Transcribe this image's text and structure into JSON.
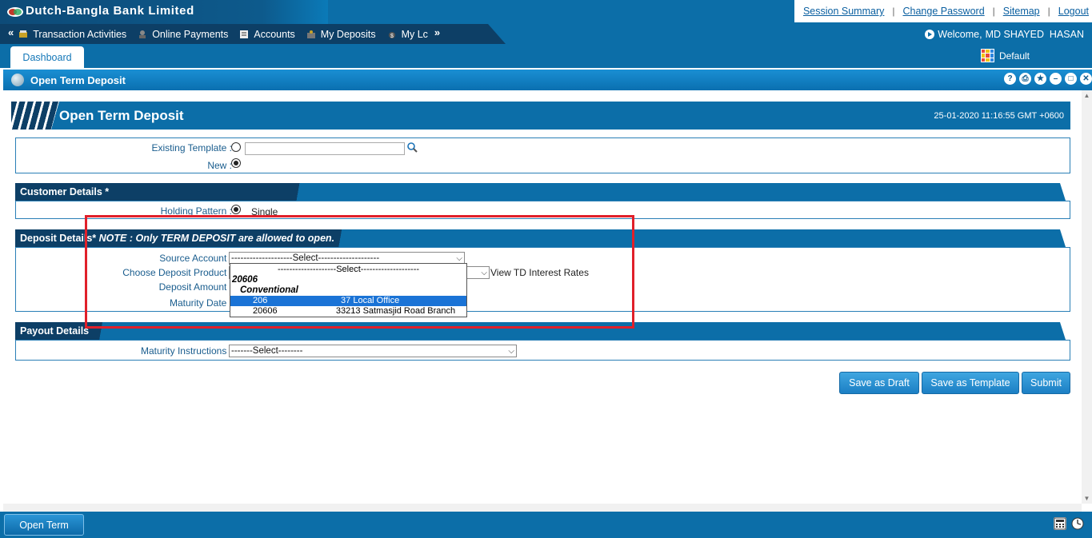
{
  "header": {
    "bank_name": "Dutch-Bangla Bank Limited",
    "links": [
      "Session Summary",
      "Change Password",
      "Sitemap",
      "Logout"
    ],
    "separator": "|"
  },
  "nav": {
    "left_arrow": "«",
    "right_arrow": "»",
    "items": [
      "Transaction Activities",
      "Online Payments",
      "Accounts",
      "My Deposits",
      "My Lc"
    ],
    "welcome_label": "Welcome,",
    "user_name": "MD SHAYED  HASAN"
  },
  "tabs": {
    "dashboard": "Dashboard",
    "layout": "Default"
  },
  "widget": {
    "title": "Open Term Deposit",
    "controls": [
      "?",
      "⎙",
      "★",
      "–",
      "□",
      "✕"
    ]
  },
  "page": {
    "title": "Open Term Deposit",
    "datetime": "25-01-2020 11:16:55 GMT +0600"
  },
  "template_section": {
    "existing_label": "Existing Template :",
    "new_label": "New :"
  },
  "customer": {
    "heading": "Customer Details *",
    "holding_label": "Holding Pattern :",
    "holding_value": "Single"
  },
  "deposit": {
    "heading": "Deposit Details*",
    "note": "NOTE : Only TERM DEPOSIT are allowed to open.",
    "source_label": "Source Account :",
    "source_selected": "--------------------Select--------------------",
    "product_label": "Choose Deposit Product :",
    "view_rates": "View TD Interest Rates",
    "amount_label": "Deposit Amount :",
    "maturity_label": "Maturity Date :",
    "dropdown_options": [
      {
        "text": "--------------------Select--------------------",
        "kind": "option",
        "selected": false
      },
      {
        "text": "20606",
        "kind": "group"
      },
      {
        "text": "Conventional",
        "kind": "group"
      },
      {
        "text": "206                              37 Local Office",
        "kind": "option",
        "selected": true
      },
      {
        "text": "20606                        33213 Satmasjid Road Branch",
        "kind": "option",
        "selected": false
      }
    ]
  },
  "payout": {
    "heading": "Payout Details",
    "maturity_instr_label": "Maturity Instructions :",
    "maturity_instr_value": "-------Select--------"
  },
  "buttons": {
    "save_draft": "Save as Draft",
    "save_template": "Save as Template",
    "submit": "Submit"
  },
  "footer": {
    "open_tab": "Open Term"
  },
  "colors": {
    "primary": "#0c6ea8",
    "dark": "#0d3f66",
    "highlight": "#e0202a",
    "selected_option": "#1a73d6"
  }
}
